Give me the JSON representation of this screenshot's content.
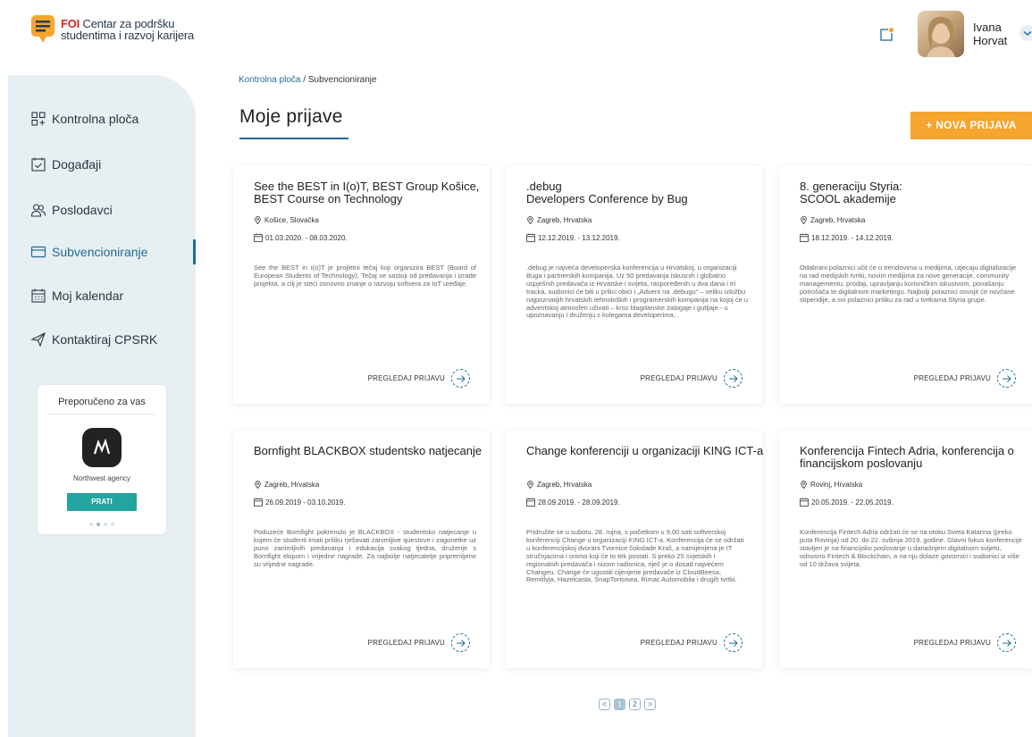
{
  "header": {
    "logo_brand": "FOI",
    "logo_line1": "Centar za podršku",
    "logo_line2": "studentima i razvoj karijera",
    "user_first": "Ivana",
    "user_last": "Horvat"
  },
  "sidebar": {
    "items": [
      {
        "label": "Kontrolna ploča",
        "icon": "dashboard-icon"
      },
      {
        "label": "Događaji",
        "icon": "calendar-check-icon"
      },
      {
        "label": "Poslodavci",
        "icon": "people-icon"
      },
      {
        "label": "Subvencioniranje",
        "icon": "credit-card-icon",
        "active": true
      },
      {
        "label": "Moj kalendar",
        "icon": "calendar-icon"
      },
      {
        "label": "Kontaktiraj CPSRK",
        "icon": "send-icon"
      }
    ],
    "recommended": {
      "title": "Preporučeno za vas",
      "name": "Northwest agency",
      "button": "PRATI"
    }
  },
  "main": {
    "breadcrumb_home": "Kontrolna ploča",
    "breadcrumb_sep": " / ",
    "breadcrumb_current": "Subvencioniranje",
    "title": "Moje prijave",
    "new_button": "+ NOVA PRIJAVA",
    "action_label": "PREGLEDAJ PRIJAVU"
  },
  "cards": [
    {
      "title": "See the BEST in I(o)T, BEST Group Košice, BEST Course on Technology",
      "location": "Košice, Slovačka",
      "dates": "01.03.2020. - 08.03.2020.",
      "description": "See the BEST in I(o)T je projletni tečaj koji organizira BEST (Board of European Students of Technology). Tečaj se sastoji od predavanja i izrade projekta, a cilj je steći osnovno znanje o razvoju softvera za IoT uređaje."
    },
    {
      "title": ".debug\nDevelopers Conference by Bug",
      "location": "Zagreb, Hrvatska",
      "dates": "12.12.2019. - 13.12.2019.",
      "description": ".debug je najveća developerska konferencija u Hrvatskoj, u organizaciji Buga i partnerskih kompanija. Uz 50 predavanja iskusnih i globalno uspješnih predavača iz Hrvatske i svijeta, raspoređenih u dva dana i tri tracka, sudionici će biti u prilici obići i „Advent na .debugu“ – veliku izložbu najpoznatijih hrvatskih tehnoloških i programerskih kompanija na kojoj će u adventskoj atmosferi uživati – kroz blagdanske zalogaje i gutljaje - u upoznavanju i druženju s kolegama developerima..."
    },
    {
      "title": "8. generaciju Styria:\nSCOOL akademije",
      "location": "Zagreb, Hrvatska",
      "dates": "18.12.2019. - 14.12.2019.",
      "description": "Odabrani polaznici učit će o trendovima u medijima, utjecaju digitalizacije na rad medijskih tvrtki, novim medijima za nove generacije, community managementu, prodaji, upravljanju korisničkim iskustvom, ponašanju potrošača te digitalnom marketingu. Najbolji polaznici osvojit će novčane stipendije, a svi polaznici priliku za rad u tvrtkama Styria grupe."
    },
    {
      "title": "Bornfight BLACKBOX studentsko natjecanje",
      "location": "Zagreb, Hrvatska",
      "dates": "26.09.2019 - 03.10.2019.",
      "description": "Poduzeće Bornfight pokrenulo je BLACKBOX - studentsko natjecanje u kojem će studenti imati priliku rješavati zanimljive questove i zagonetke uz puno zanimljivih predavanja i edukacija svakog tjedna, druženje s Bornfight ekipom i vrijedne nagrade. Za najbolje natjecatelje pripremljene su vrijedne nagrade."
    },
    {
      "title": "Change konferenciji u organizaciji KING ICT-a",
      "location": "Zagreb, Hrvatska",
      "dates": "28.09.2019. - 28.09.2019.",
      "description": "Pridružite se u subotu, 28. rujna, s početkom u 9,00 sati softverskoj konferenciji Change u organizaciji KING ICT-a. Konferencija će se održati u konferencijskoj dvorani Tvornice čokolade Kraš, a namijenjena je IT stručnjacima i onima koji će to tek postati. S preko 25 svjetskih i regionalnih predavača i nizom radionica, riječ je o dosad najvećem Changeu. Change će ugostiti cijenjene predavače iz CloudBeesa, Remitlyja, Hazelcasta, SnapTortoisea, Rimac Automobila i drugih tvrtki."
    },
    {
      "title": "Konferencija Fintech Adria, konferencija o financijskom poslovanju",
      "location": "Rovinj, Hrvatska",
      "dates": "20.05.2019. - 22.05.2019.",
      "description": "Konferencija Fintech Adria održati će se na otoku Sveta Katarina (preko puta Rovinja) od 20. do 22. svibnja 2019. godine. Glavni fokus konferencije stavljen je na financijsko poslovanje u današnjem digitalnom svijetu, odnosno Fintech & Blockchain, a na nju dolaze govornici i sudionici iz više od 10 država svijeta."
    }
  ],
  "pagination": {
    "prev": "<",
    "pages": [
      "1",
      "2"
    ],
    "current": "1",
    "next": ">"
  },
  "colors": {
    "accent": "#1f6c98",
    "cta": "#f6a52e",
    "follow": "#22a4a0",
    "sidebar_bg": "#e7eff2"
  }
}
